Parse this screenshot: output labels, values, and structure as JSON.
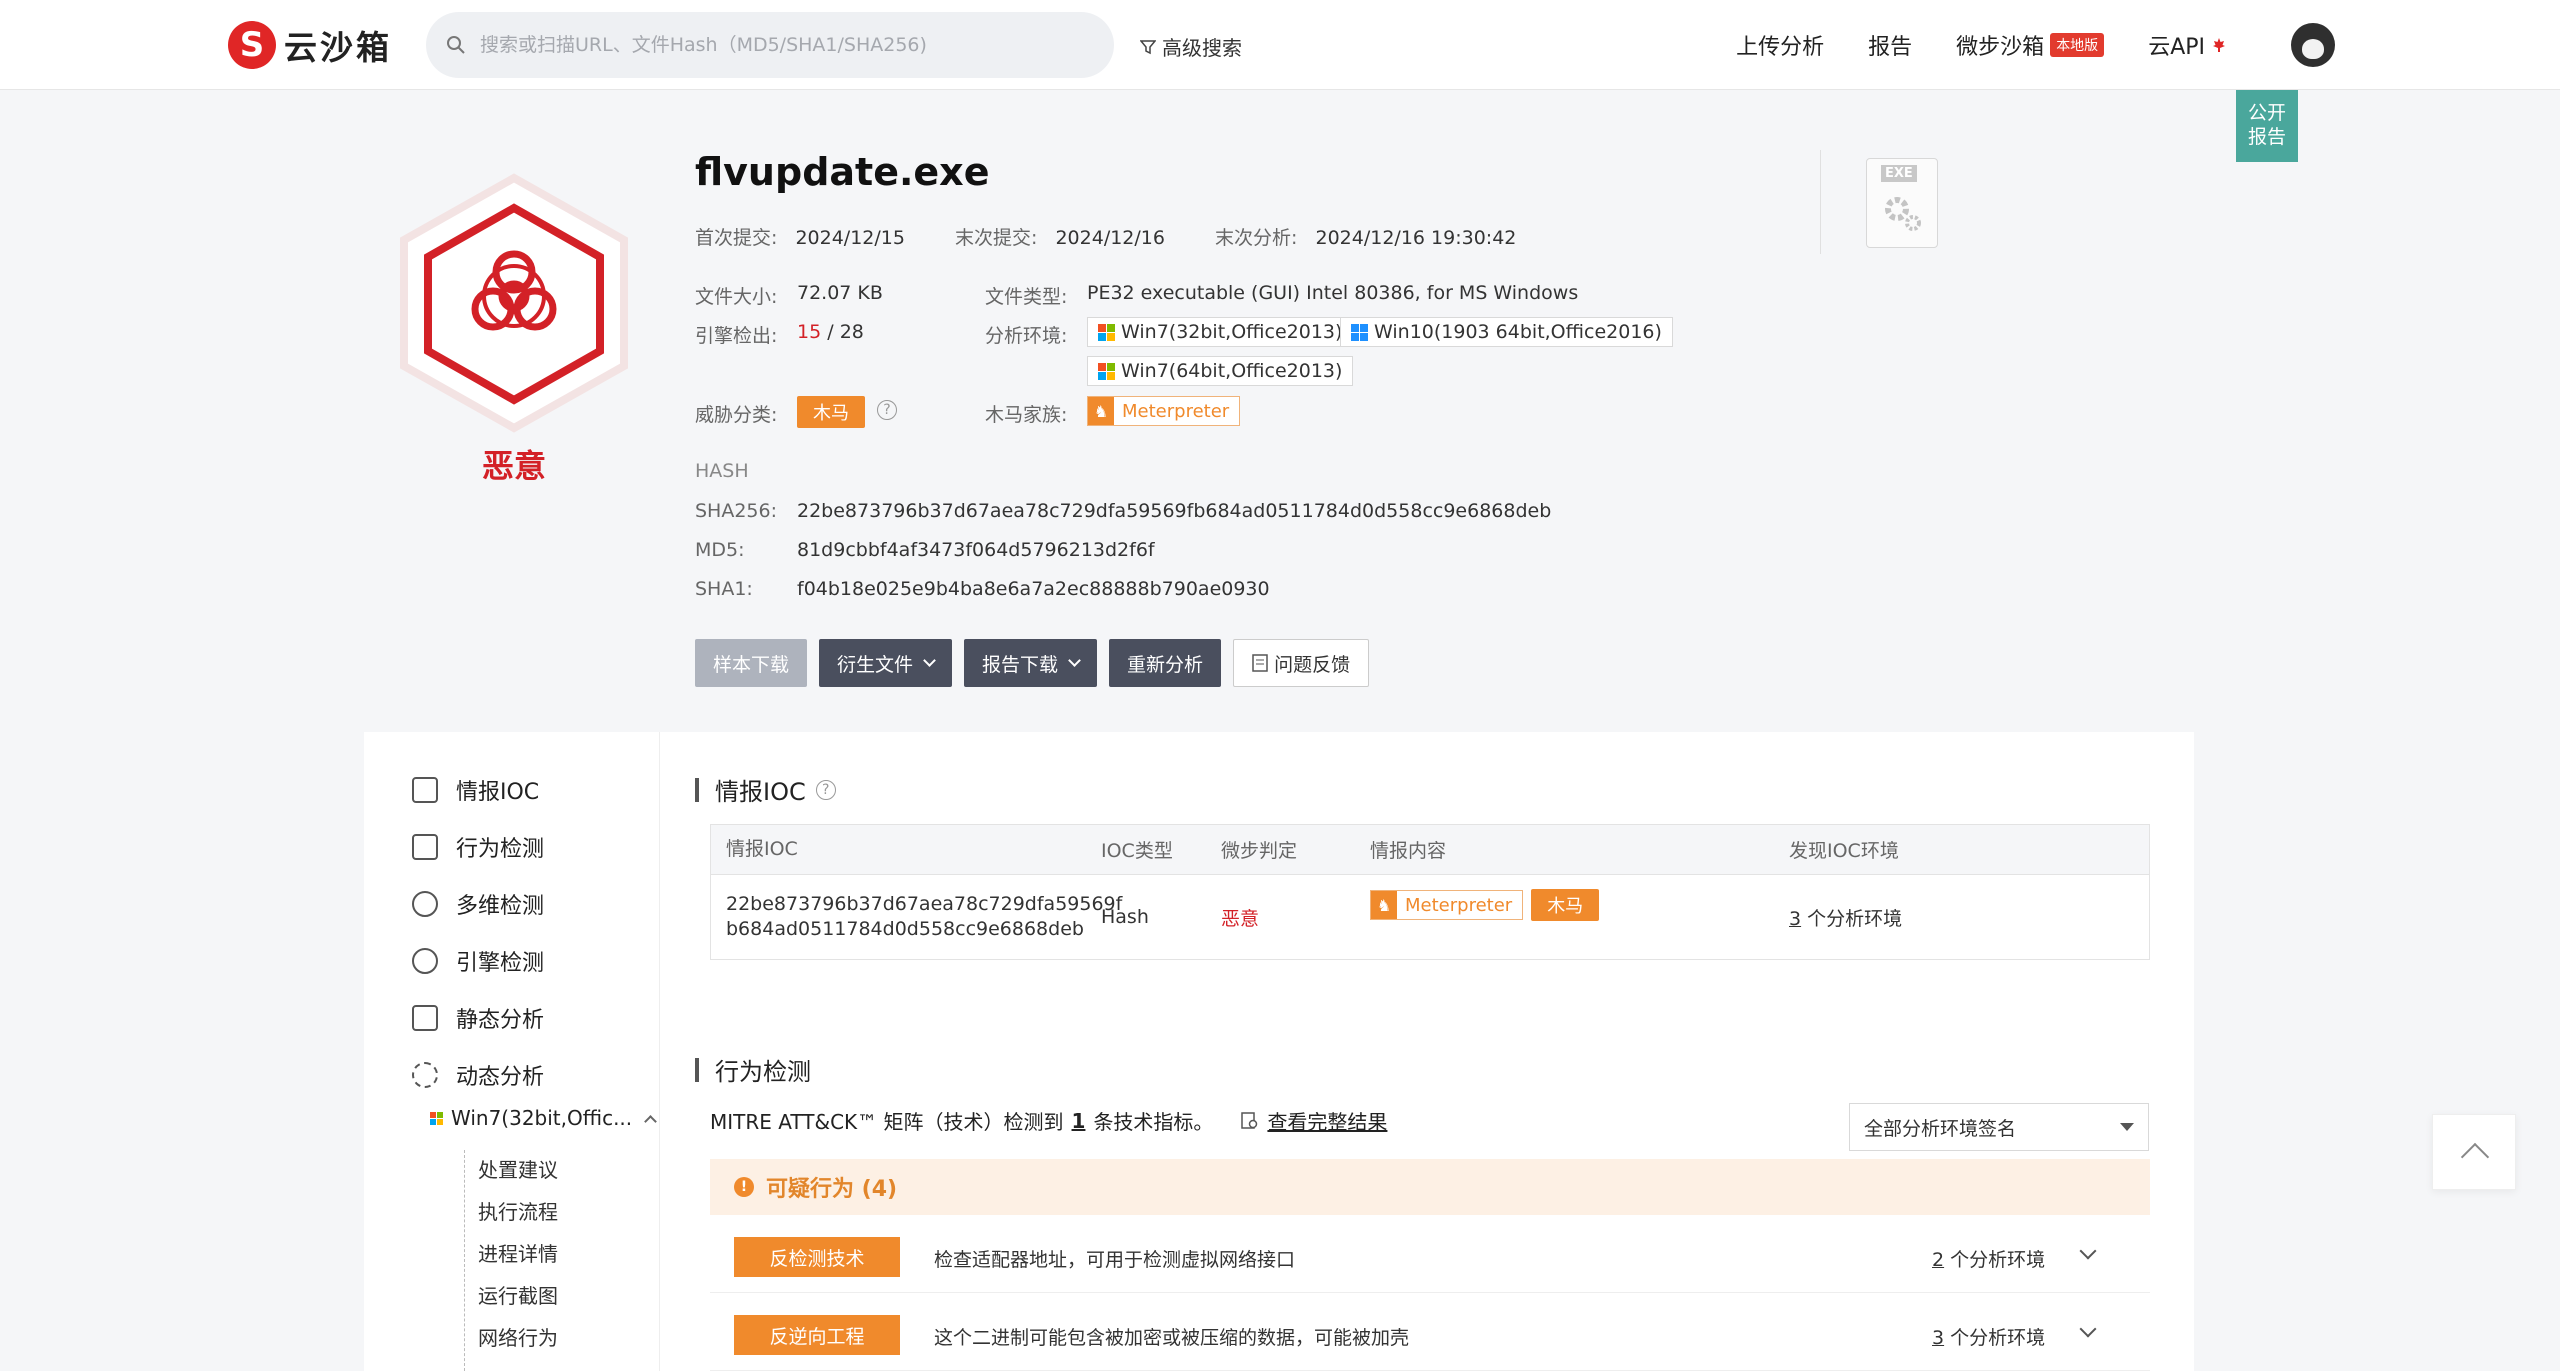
{
  "header": {
    "logo_mark": "S",
    "logo_text": "云沙箱",
    "search_placeholder": "搜索或扫描URL、文件Hash（MD5/SHA1/SHA256)",
    "advanced_search": "高级搜索",
    "nav": [
      {
        "label": "上传分析"
      },
      {
        "label": "报告"
      },
      {
        "label": "微步沙箱",
        "badge": "本地版"
      },
      {
        "label": "云API"
      }
    ]
  },
  "public_report": [
    "公开",
    "报告"
  ],
  "summary": {
    "verdict": "恶意",
    "file_name": "flvupdate.exe",
    "first_submit_label": "首次提交:",
    "first_submit": "2024/12/15",
    "last_submit_label": "末次提交:",
    "last_submit": "2024/12/16",
    "last_analysis_label": "末次分析:",
    "last_analysis": "2024/12/16 19:30:42",
    "size_label": "文件大小:",
    "size": "72.07 KB",
    "type_label": "文件类型:",
    "type": "PE32 executable (GUI) Intel 80386, for MS Windows",
    "engine_label": "引擎检出:",
    "engine_hits": "15",
    "engine_sep": "/",
    "engine_total": "28",
    "env_label": "分析环境:",
    "envs": [
      "Win7(32bit,Office2013)",
      "Win10(1903 64bit,Office2016)",
      "Win7(64bit,Office2013)"
    ],
    "threat_label": "威胁分类:",
    "threat_tag": "木马",
    "family_label": "木马家族:",
    "family": "Meterpreter",
    "file_icon_tag": "EXE",
    "hash_heading": "HASH",
    "sha256_label": "SHA256:",
    "sha256": "22be873796b37d67aea78c729dfa59569fb684ad0511784d0d558cc9e6868deb",
    "md5_label": "MD5:",
    "md5": "81d9cbbf4af3473f064d5796213d2f6f",
    "sha1_label": "SHA1:",
    "sha1": "f04b18e025e9b4ba8e6a7a2ec88888b790ae0930"
  },
  "actions": {
    "sample_download": "样本下载",
    "derived_files": "衍生文件",
    "report_download": "报告下载",
    "reanalyze": "重新分析",
    "feedback": "问题反馈"
  },
  "sidebar": {
    "items": [
      "情报IOC",
      "行为检测",
      "多维检测",
      "引擎检测",
      "静态分析",
      "动态分析"
    ],
    "env": "Win7(32bit,Offic...",
    "leaves": [
      "处置建议",
      "执行流程",
      "进程详情",
      "运行截图",
      "网络行为",
      "...."
    ]
  },
  "ioc": {
    "title": "情报IOC",
    "columns": [
      "情报IOC",
      "IOC类型",
      "微步判定",
      "情报内容",
      "发现IOC环境"
    ],
    "row": {
      "ioc_line1": "22be873796b37d67aea78c729dfa59569f",
      "ioc_line2": "b684ad0511784d0d558cc9e6868deb",
      "type": "Hash",
      "verdict": "恶意",
      "family": "Meterpreter",
      "tag": "木马",
      "env_count": "3",
      "env_suffix": " 个分析环境"
    }
  },
  "behavior": {
    "title": "行为检测",
    "mitre_prefix": "MITRE ATT&CK™ 矩阵（技术）检测到",
    "mitre_count": "1",
    "mitre_suffix": "条技术指标。",
    "view_full": "查看完整结果",
    "select_value": "全部分析环境签名",
    "suspicious_header": "可疑行为 (4)",
    "rows": [
      {
        "tag": "反检测技术",
        "desc": "检查适配器地址，可用于检测虚拟网络接口",
        "env_count": "2",
        "env_suffix": " 个分析环境"
      },
      {
        "tag": "反逆向工程",
        "desc": "这个二进制可能包含被加密或被压缩的数据，可能被加壳",
        "env_count": "3",
        "env_suffix": " 个分析环境"
      }
    ]
  },
  "colors": {
    "malicious": "#d32127",
    "accent_orange": "#f08a2c",
    "teal": "#4aa79c"
  }
}
